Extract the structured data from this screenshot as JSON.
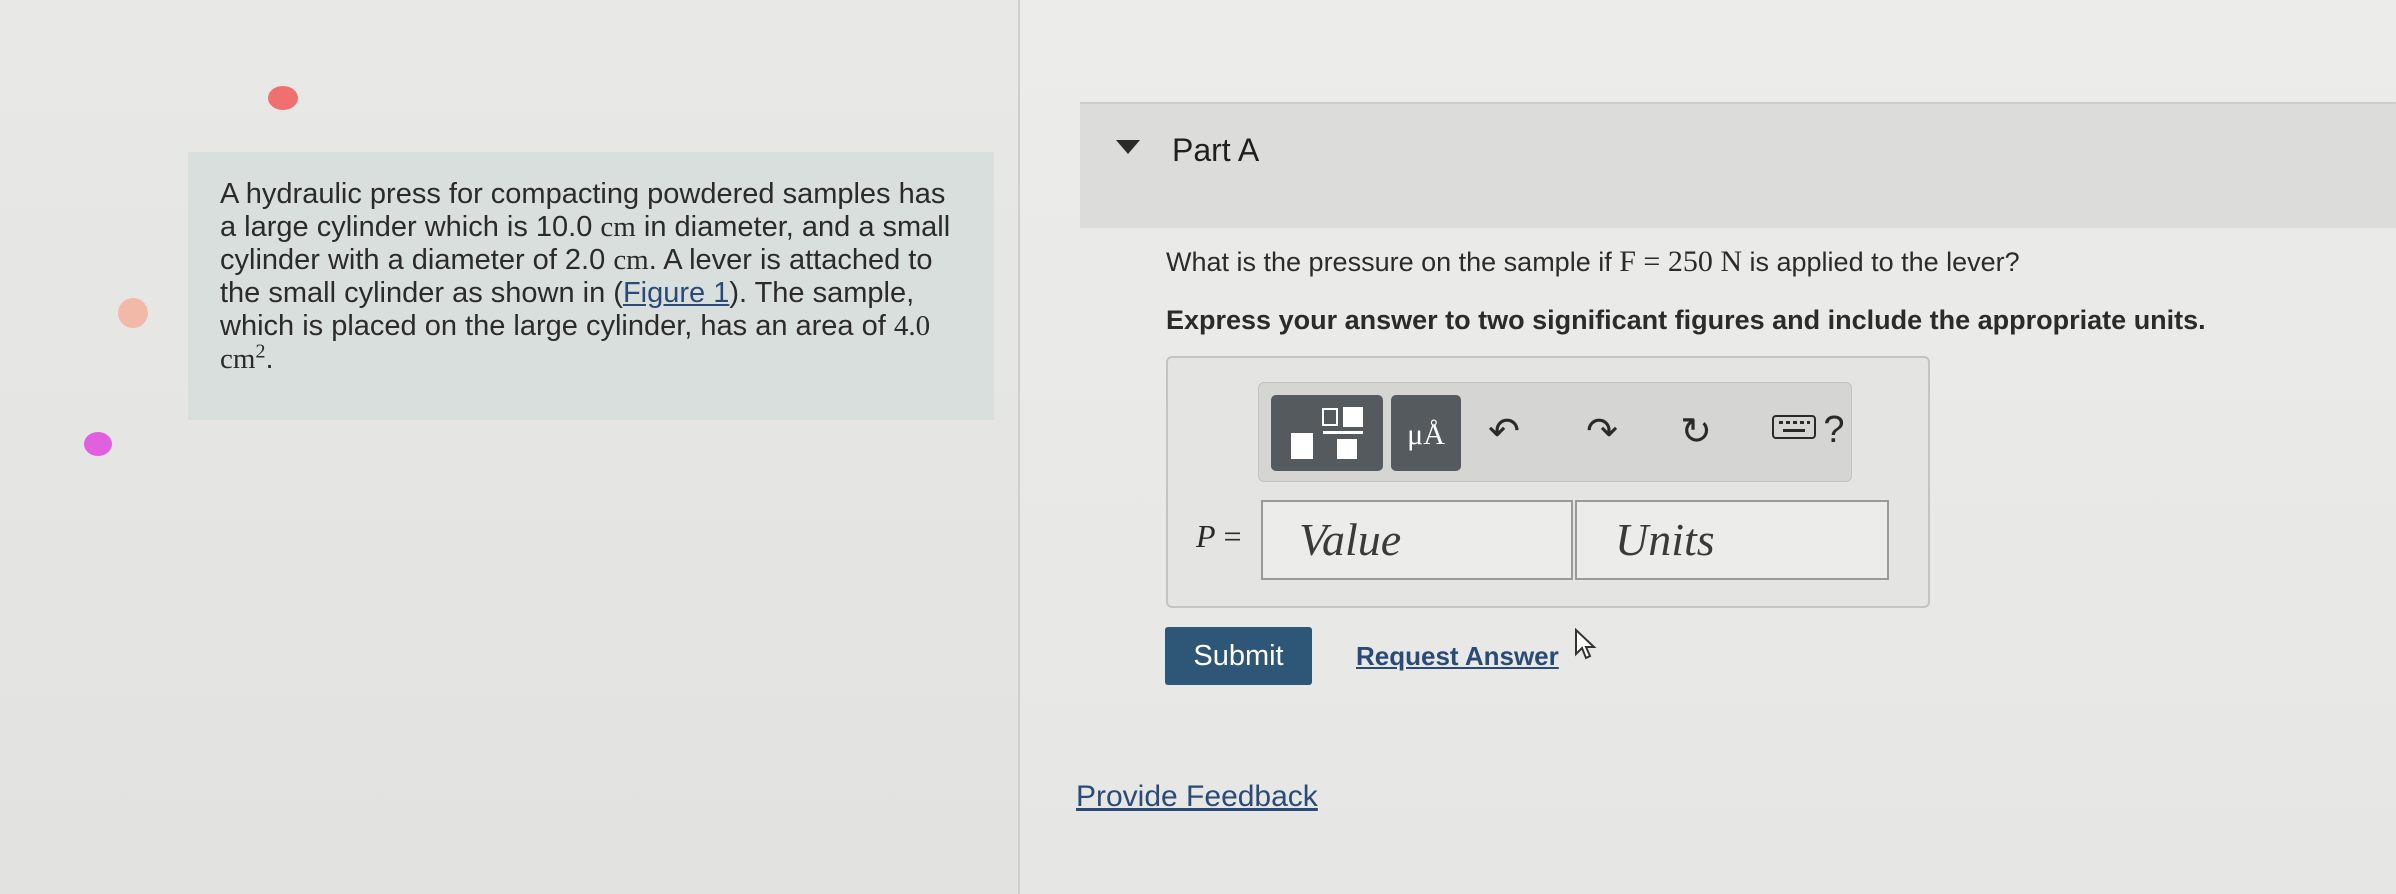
{
  "problem": {
    "segments": [
      "A hydraulic press for compacting powdered samples has a large cylinder which is 10.0 ",
      "cm",
      " in diameter, and a small cylinder with a diameter of 2.0 ",
      "cm",
      ". A lever is attached to the small cylinder as shown in (",
      "Figure 1",
      "). The sample, which is placed on the large cylinder, has an area of ",
      "4.0 cm",
      "2",
      "."
    ]
  },
  "part": {
    "title": "Part A"
  },
  "question": {
    "before": "What is the pressure on the sample if ",
    "math": "F = 250  N",
    "after": " is applied to the lever?"
  },
  "instructions": "Express your answer to two significant figures and include the appropriate units.",
  "toolbar": {
    "units_label": "μÅ",
    "undo": "↶",
    "redo": "↷",
    "reset": "↻",
    "help": "?"
  },
  "answer": {
    "variable": "P",
    "equals": " =",
    "value_placeholder": "Value",
    "units_placeholder": "Units"
  },
  "actions": {
    "submit": "Submit",
    "request_answer": "Request Answer",
    "provide_feedback": "Provide Feedback"
  },
  "colors": {
    "submit_bg": "#2d5677",
    "link": "#2a4a78",
    "problem_bg": "#d9dfdc"
  }
}
